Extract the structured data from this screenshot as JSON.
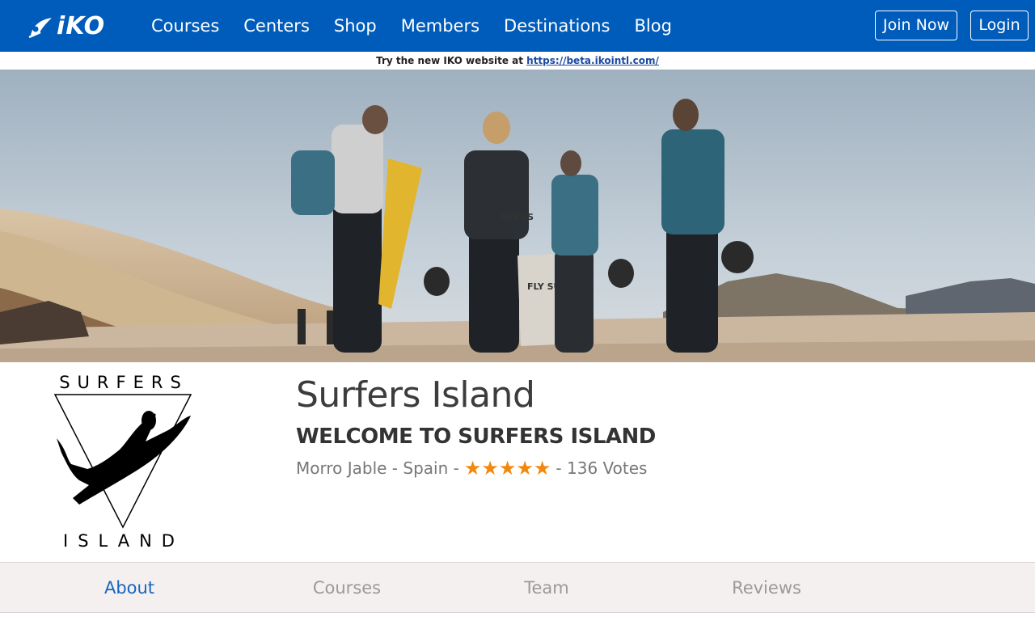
{
  "nav": {
    "logo_text": "iKO",
    "links": [
      "Courses",
      "Centers",
      "Shop",
      "Members",
      "Destinations",
      "Blog"
    ],
    "join_label": "Join Now",
    "login_label": "Login",
    "bg_color": "#005cbb"
  },
  "notice": {
    "text": "Try the new IKO website at ",
    "link": "https://beta.ikointl.com/"
  },
  "hero": {
    "board_text": "",
    "bag_text_1": "FLY SUR FER",
    "bag_text_2": "NEXUS"
  },
  "center": {
    "logo_top": "SURFERS",
    "logo_bottom": "ISLAND",
    "title": "Surfers Island",
    "subtitle": "WELCOME TO SURFERS ISLAND",
    "location": "Morro Jable - Spain -",
    "stars": "★★★★★",
    "rating": 5,
    "votes": "- 136 Votes",
    "star_color": "#f2880e"
  },
  "tabs": {
    "about": "About",
    "courses": "Courses",
    "team": "Team",
    "reviews": "Reviews",
    "active": "About"
  }
}
